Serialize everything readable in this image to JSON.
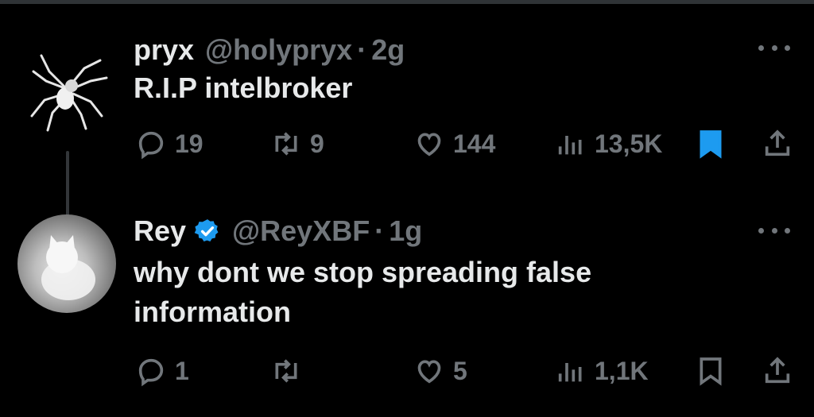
{
  "tweets": [
    {
      "name": "pryx",
      "handle": "@holypryx",
      "separator": "·",
      "time": "2g",
      "text": "R.I.P intelbroker",
      "verified": false,
      "avatar_icon": "spider-avatar",
      "stats": {
        "replies": "19",
        "retweets": "9",
        "likes": "144",
        "views": "13,5K"
      },
      "bookmarked": true
    },
    {
      "name": "Rey",
      "handle": "@ReyXBF",
      "separator": "·",
      "time": "1g",
      "text": "why dont we stop spreading false information",
      "verified": true,
      "avatar_icon": "cat-avatar",
      "stats": {
        "replies": "1",
        "retweets": "",
        "likes": "5",
        "views": "1,1K"
      },
      "bookmarked": false
    }
  ],
  "colors": {
    "background": "#000000",
    "text": "#e7e9ea",
    "muted": "#71767b",
    "accent": "#1d9bf0"
  }
}
